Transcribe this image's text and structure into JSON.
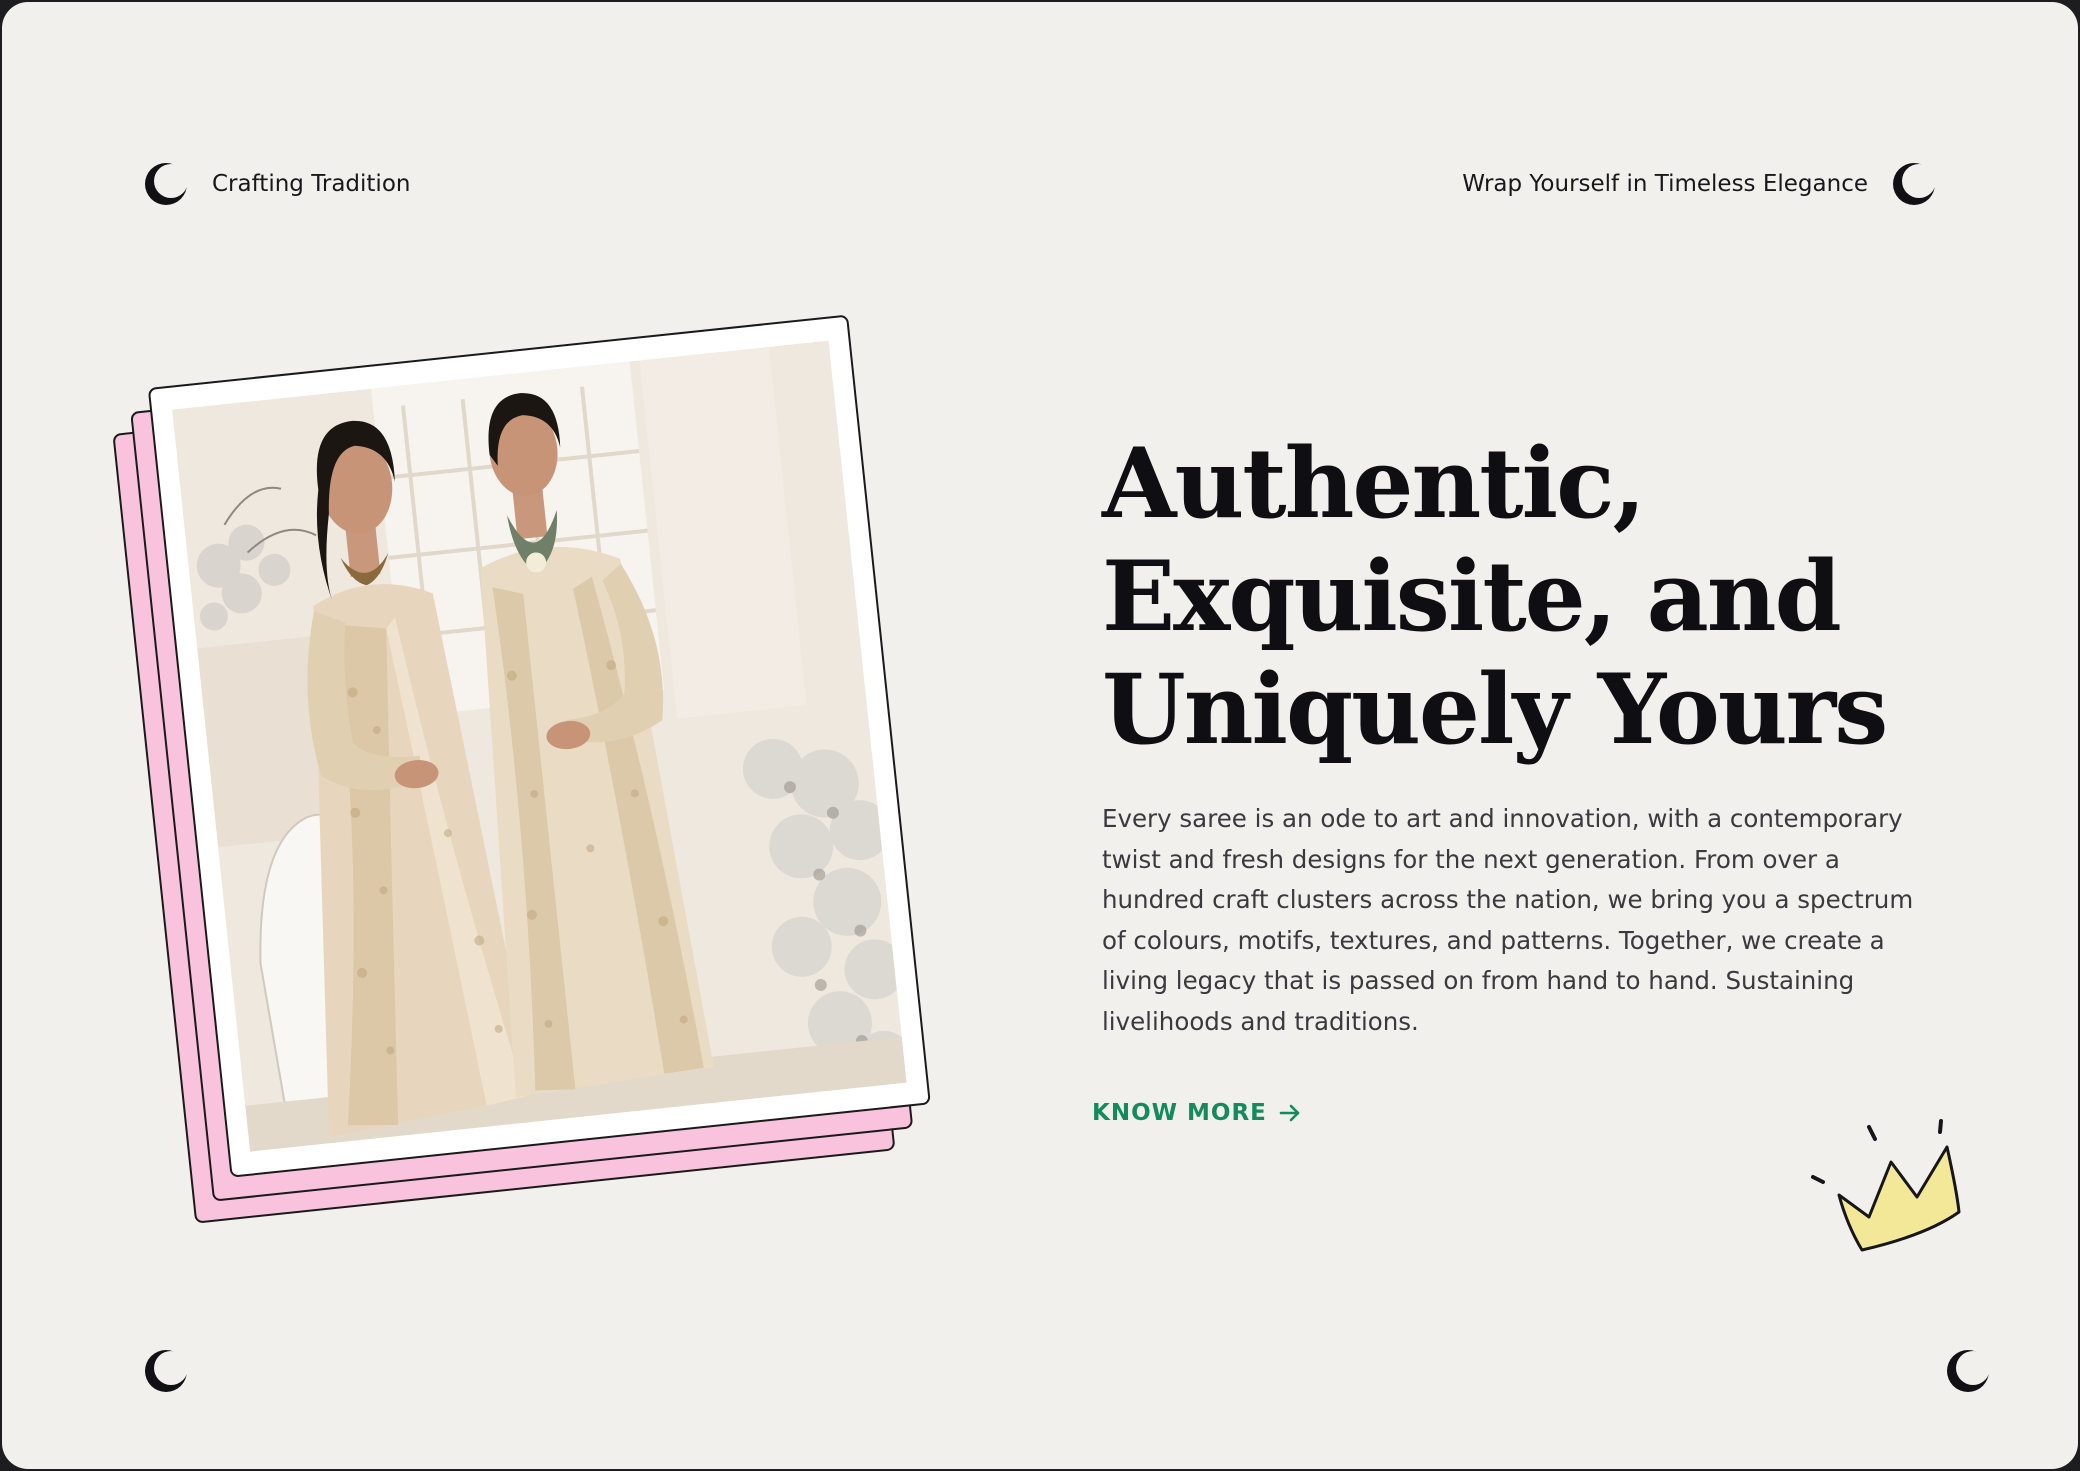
{
  "header": {
    "left_text": "Crafting Tradition",
    "right_text": "Wrap Yourself in Timeless Elegance"
  },
  "hero": {
    "headline_lines": [
      "Authentic,",
      "Exquisite, and",
      "Uniquely Yours"
    ],
    "description": "Every saree is an ode to art and innovation, with a contemporary twist and fresh designs for the next generation. From over a hundred craft clusters across the nation, we bring you a spectrum of colours, motifs, textures, and patterns. Together, we create a living legacy that is passed on from hand to hand. Sustaining livelihoods and traditions.",
    "cta_label": "KNOW MORE",
    "cta_icon": "arrow-right-icon"
  },
  "image": {
    "subject": "two-women-in-embroidered-ivory-outfits",
    "icon": "photo"
  },
  "decorations": {
    "corner_icon": "crescent-moon-icon",
    "crown_icon": "crown-icon"
  },
  "colors": {
    "background": "#f1f0ec",
    "headline": "#0f0e13",
    "body": "#3a393e",
    "cta": "#158a5f",
    "card_back": "#f9c3de",
    "crown_fill": "#f3e897"
  }
}
